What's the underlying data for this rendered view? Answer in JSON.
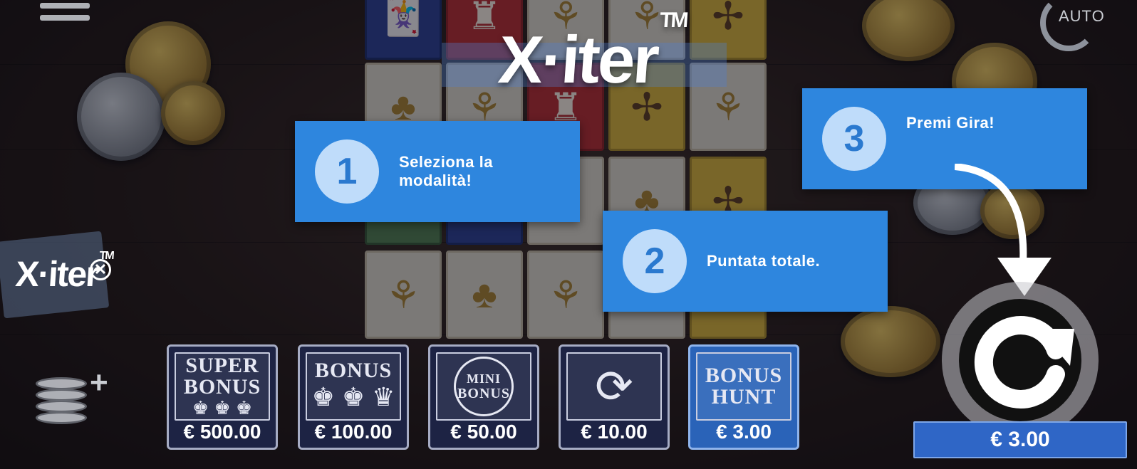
{
  "game": {
    "logo_text": "X·iter",
    "logo_tm": "TM",
    "badge_logo_text": "X·iter",
    "badge_logo_tm": "TM"
  },
  "controls": {
    "menu_icon": "menu-icon",
    "auto_label": "AUTO",
    "close_glyph": "✕",
    "spin_icon": "spin-icon",
    "total_bet": "€ 3.00"
  },
  "tips": [
    {
      "number": "1",
      "text": "Seleziona la\nmodalità!"
    },
    {
      "number": "2",
      "text": "Puntata totale."
    },
    {
      "number": "3",
      "text": "Premi Gira!"
    }
  ],
  "bonus_cards": [
    {
      "title_line1": "SUPER",
      "title_line2": "BONUS",
      "icon": "♚ ♚ ♚",
      "price": "€ 500.00"
    },
    {
      "title_line1": "BONUS",
      "title_line2": "",
      "icon": "♚ ♚ ♛",
      "price": "€ 100.00"
    },
    {
      "title_line1": "MINI",
      "title_line2": "BONUS",
      "icon": "",
      "price": "€ 50.00"
    },
    {
      "title_line1": "",
      "title_line2": "",
      "icon": "⟳",
      "price": "€ 10.00"
    },
    {
      "title_line1": "BONUS",
      "title_line2": "HUNT",
      "icon": "",
      "price": "€ 3.00"
    }
  ],
  "colors": {
    "tooltip_bg": "#2e86de",
    "tooltip_circle": "#bfdcfa",
    "total_bg": "#2f66c6",
    "card_bg": "#1d2344",
    "card_active_bg": "#2a63b8"
  }
}
